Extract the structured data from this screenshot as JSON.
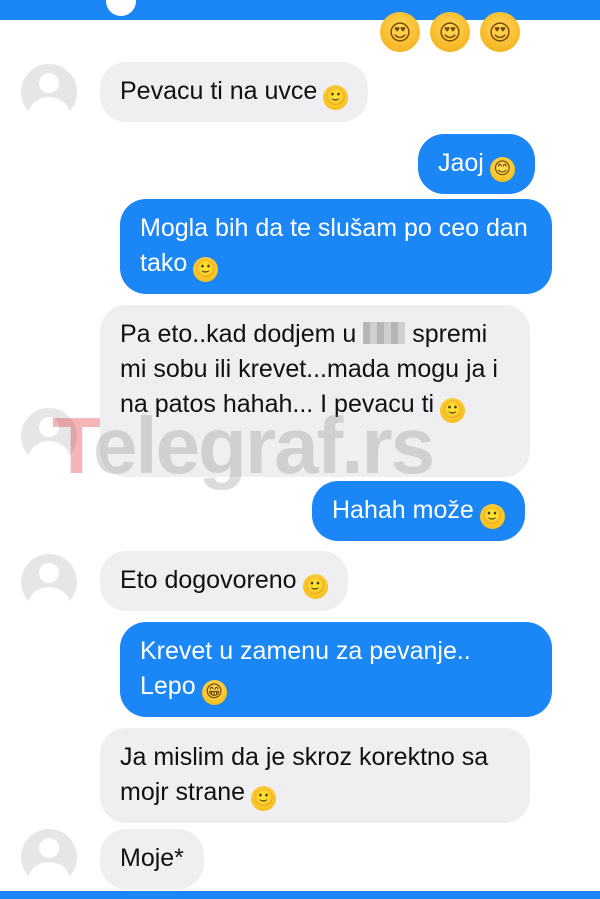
{
  "header": {
    "title": ""
  },
  "top_emojis": [
    "😍",
    "😍",
    "😍"
  ],
  "messages": [
    {
      "side": "in",
      "text": "Pevacu ti na uvce",
      "emoji": "🙂"
    },
    {
      "side": "out",
      "text": "Jaoj",
      "emoji": "😊"
    },
    {
      "side": "out",
      "text": "Mogla bih da te slušam po ceo dan tako",
      "emoji": "🙂"
    },
    {
      "side": "in",
      "text_before_censor": "Pa eto..kad dodjem u",
      "text_after_censor": "spremi mi sobu ili krevet...mada mogu ja i na patos hahah... I pevacu ti",
      "emoji": "🙂"
    },
    {
      "side": "out",
      "text": "Hahah može",
      "emoji": "🙂"
    },
    {
      "side": "in",
      "text": "Eto dogovoreno",
      "emoji": "🙂"
    },
    {
      "side": "out",
      "text": "Krevet u zamenu za pevanje.. Lepo",
      "emoji": "😁"
    },
    {
      "side": "in",
      "text": "Ja mislim da je skroz korektno sa mojr strane",
      "emoji": "🙂"
    },
    {
      "side": "in",
      "text": "Moje*"
    }
  ],
  "watermark": {
    "first": "T",
    "rest": "elegraf.rs"
  },
  "colors": {
    "sent_bubble": "#1b86f5",
    "received_bubble": "#efeff2",
    "header_bar": "#1b86f5"
  }
}
